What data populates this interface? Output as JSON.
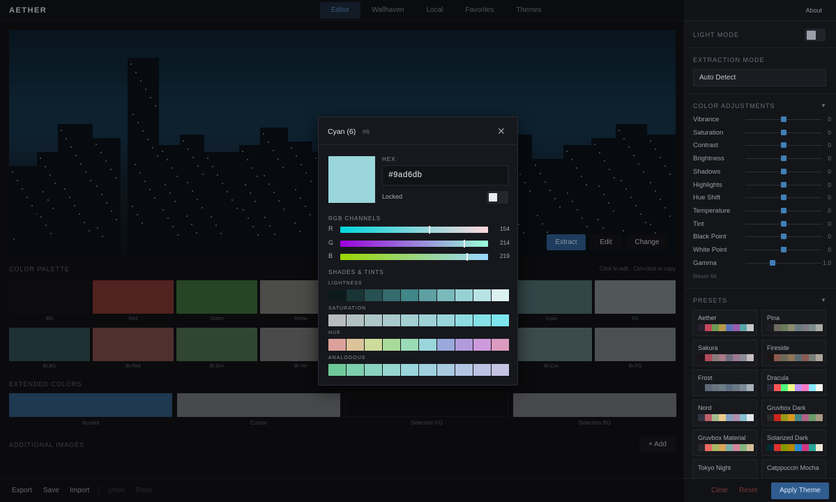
{
  "app": {
    "title": "AETHER"
  },
  "nav": {
    "tabs": [
      "Editor",
      "Wallhaven",
      "Local",
      "Favorites",
      "Themes"
    ],
    "active": "Editor",
    "about": "About"
  },
  "hero": {
    "buttons": {
      "extract": "Extract",
      "edit": "Edit",
      "change": "Change"
    }
  },
  "palette": {
    "title": "COLOR PALETTE",
    "hint": "Click to edit · Ctrl+click to copy",
    "row1": [
      {
        "label": "BG",
        "color": "#141519"
      },
      {
        "label": "Red",
        "color": "#7b3532"
      },
      {
        "label": "Green",
        "color": "#3b6b3a"
      },
      {
        "label": "Yellow",
        "color": "#737571"
      },
      {
        "label": "",
        "color": "#3f4c52"
      },
      {
        "label": "",
        "color": "#44525a"
      },
      {
        "label": "Cyan",
        "color": "#4d6b6d"
      },
      {
        "label": "FG",
        "color": "#7d8487"
      }
    ],
    "row2": [
      {
        "label": "Br.BG",
        "color": "#2f4c50"
      },
      {
        "label": "Br.Red",
        "color": "#7a4a48"
      },
      {
        "label": "Br.Grn",
        "color": "#4b6c4c"
      },
      {
        "label": "Br.Yel",
        "color": "#707270"
      },
      {
        "label": "",
        "color": "#4d6167"
      },
      {
        "label": "",
        "color": "#566a70"
      },
      {
        "label": "Br.Cyn",
        "color": "#5b7375"
      },
      {
        "label": "Br.FG",
        "color": "#747a7b"
      }
    ]
  },
  "extended": {
    "title": "EXTENDED COLORS",
    "items": [
      {
        "label": "Accent",
        "color": "#2e577b"
      },
      {
        "label": "Cursor",
        "color": "#6e7072"
      },
      {
        "label": "Selection FG",
        "color": "#111215"
      },
      {
        "label": "Selection BG",
        "color": "#6f7173"
      }
    ]
  },
  "additional": {
    "title": "ADDITIONAL IMAGES",
    "add": "+ Add"
  },
  "bottom": {
    "export": "Export",
    "save": "Save",
    "import": "Import",
    "undo": "Undo",
    "redo": "Redo",
    "clear": "Clear",
    "reset": "Reset",
    "apply": "Apply Theme"
  },
  "sidebar": {
    "light_mode": "LIGHT MODE",
    "extraction_mode": "EXTRACTION MODE",
    "extraction_value": "Auto Detect",
    "adjust_title": "COLOR ADJUSTMENTS",
    "adjustments": [
      {
        "name": "Vibrance",
        "value": "0",
        "pos": 0.5
      },
      {
        "name": "Saturation",
        "value": "0",
        "pos": 0.5
      },
      {
        "name": "Contrast",
        "value": "0",
        "pos": 0.5
      },
      {
        "name": "Brightness",
        "value": "0",
        "pos": 0.5
      },
      {
        "name": "Shadows",
        "value": "0",
        "pos": 0.5
      },
      {
        "name": "Highlights",
        "value": "0",
        "pos": 0.5
      },
      {
        "name": "Hue Shift",
        "value": "0",
        "pos": 0.5
      },
      {
        "name": "Temperature",
        "value": "0",
        "pos": 0.5
      },
      {
        "name": "Tint",
        "value": "0",
        "pos": 0.5
      },
      {
        "name": "Black Point",
        "value": "0",
        "pos": 0.5
      },
      {
        "name": "White Point",
        "value": "0",
        "pos": 0.5
      },
      {
        "name": "Gamma",
        "value": "1.0",
        "pos": 0.35
      }
    ],
    "reset_all": "Reset All",
    "presets_title": "PRESETS",
    "presets": [
      {
        "name": "Aether",
        "colors": [
          "#2a2030",
          "#c2485a",
          "#6c9a52",
          "#b59a4a",
          "#5a73b8",
          "#9a5cae",
          "#5aa6a8",
          "#c9c9c9"
        ]
      },
      {
        "name": "Pina",
        "colors": [
          "#1d1e22",
          "#6f6a60",
          "#6e7b5a",
          "#8a8a72",
          "#6a7a80",
          "#7b7a82",
          "#7d8c8c",
          "#a9aaa4"
        ]
      },
      {
        "name": "Sakura",
        "colors": [
          "#1a1214",
          "#b04a5a",
          "#8a7a7a",
          "#a77c86",
          "#6f6c7e",
          "#9a7a90",
          "#8c8c9c",
          "#c8bcc0"
        ]
      },
      {
        "name": "Fireside",
        "colors": [
          "#1b1615",
          "#8a5a4c",
          "#6e6a58",
          "#8e7458",
          "#5e6a72",
          "#8a5c54",
          "#7a7e7a",
          "#aca49a"
        ]
      },
      {
        "name": "Frost",
        "colors": [
          "#161a1e",
          "#5c6a78",
          "#66747e",
          "#6e7c86",
          "#5e6e80",
          "#6c7886",
          "#7a8a96",
          "#a6b0b8"
        ]
      },
      {
        "name": "Dracula",
        "colors": [
          "#282a36",
          "#ff5555",
          "#50fa7b",
          "#f1fa8c",
          "#bd93f9",
          "#ff79c6",
          "#8be9fd",
          "#f8f8f2"
        ]
      },
      {
        "name": "Nord",
        "colors": [
          "#2e3440",
          "#bf616a",
          "#a3be8c",
          "#ebcb8b",
          "#81a1c1",
          "#b48ead",
          "#88c0d0",
          "#e5e9f0"
        ]
      },
      {
        "name": "Gruvbox Dark",
        "colors": [
          "#282828",
          "#cc241d",
          "#98971a",
          "#d79921",
          "#458588",
          "#b16286",
          "#689d6a",
          "#a89984"
        ]
      },
      {
        "name": "Gruvbox Material",
        "colors": [
          "#282828",
          "#ea6962",
          "#a9b665",
          "#d8a657",
          "#7daea3",
          "#d3869b",
          "#89b482",
          "#d4be98"
        ]
      },
      {
        "name": "Solarized Dark",
        "colors": [
          "#002b36",
          "#dc322f",
          "#859900",
          "#b58900",
          "#268bd2",
          "#d33682",
          "#2aa198",
          "#eee8d5"
        ]
      },
      {
        "name": "Tokyo Night",
        "colors": []
      },
      {
        "name": "Catppuccin Mocha",
        "colors": []
      }
    ]
  },
  "modal": {
    "title": "Cyan (6)",
    "index": "#6",
    "color": "#9ad6db",
    "hex_label": "HEX",
    "hex_value": "#9ad6db",
    "locked_label": "Locked",
    "rgb_title": "RGB CHANNELS",
    "channels": [
      {
        "ch": "R",
        "value": "154",
        "frac": 0.604,
        "gradient": "linear-gradient(90deg,#00d6db,#ffd6db)"
      },
      {
        "ch": "G",
        "value": "214",
        "frac": 0.839,
        "gradient": "linear-gradient(90deg,#9a00db,#9affdb)"
      },
      {
        "ch": "B",
        "value": "219",
        "frac": 0.859,
        "gradient": "linear-gradient(90deg,#9ad600,#9ad6ff)"
      }
    ],
    "shades_title": "SHADES & TINTS",
    "rows": [
      {
        "label": "LIGHTNESS",
        "colors": [
          "#0d1a1b",
          "#1a3536",
          "#275052",
          "#346b6d",
          "#418689",
          "#5ea0a3",
          "#7ab9bc",
          "#97d1d4",
          "#b8e2e4",
          "#dcf1f2"
        ]
      },
      {
        "label": "SATURATION",
        "colors": [
          "#b8bcbc",
          "#b3c1c2",
          "#adc6c8",
          "#a8cacd",
          "#a3ced2",
          "#9ed2d6",
          "#98d6db",
          "#8fdbe1",
          "#86e0e7",
          "#7ce5ed"
        ]
      },
      {
        "label": "HUE",
        "colors": [
          "#dba19a",
          "#dbc49a",
          "#cedb9a",
          "#a8db9a",
          "#9adbb6",
          "#9ad6db",
          "#9aa8db",
          "#b09adb",
          "#cd9adb",
          "#db9ac0"
        ]
      },
      {
        "label": "ANALOGOUS",
        "colors": [
          "#6fc89a",
          "#7dcfae",
          "#8ad3c1",
          "#95d6d0",
          "#9ad6db",
          "#a0d0df",
          "#a8cae1",
          "#b1c5e2",
          "#bbc2e3",
          "#c5c3e4"
        ]
      }
    ]
  }
}
